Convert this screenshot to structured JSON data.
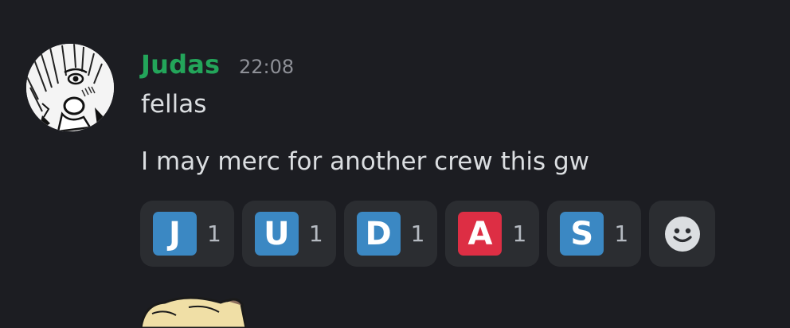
{
  "message": {
    "author": "Judas",
    "time": "22:08",
    "lines": [
      "fellas",
      "I may merc for another crew this gw"
    ]
  },
  "reactions": [
    {
      "emoji": "J",
      "count": "1",
      "color": "#3b88c3"
    },
    {
      "emoji": "U",
      "count": "1",
      "color": "#3b88c3"
    },
    {
      "emoji": "D",
      "count": "1",
      "color": "#3b88c3"
    },
    {
      "emoji": "A",
      "count": "1",
      "color": "#dd2e44"
    },
    {
      "emoji": "S",
      "count": "1",
      "color": "#3b88c3"
    }
  ],
  "add_reaction_icon": "smile-icon",
  "colors": {
    "background": "#1c1d22",
    "username": "#23a55a",
    "timestamp": "#8e9097",
    "text": "#dbdee1",
    "reaction_bg": "#2b2d31"
  }
}
